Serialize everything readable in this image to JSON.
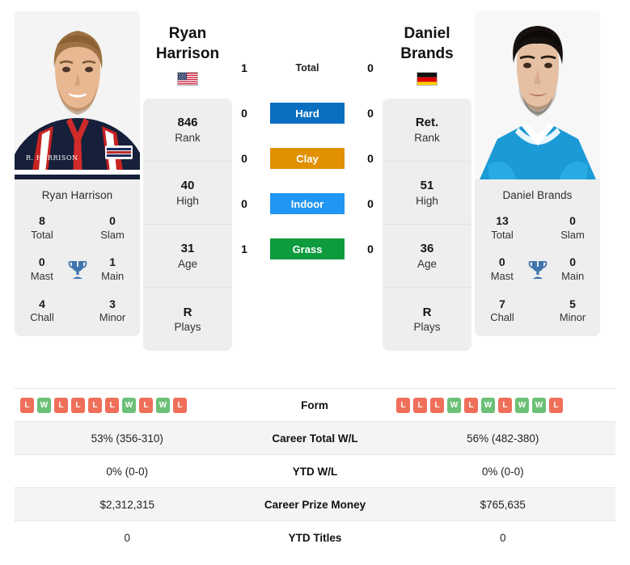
{
  "players": {
    "left": {
      "first_name": "Ryan",
      "last_name": "Harrison",
      "full_name": "Ryan Harrison",
      "country_code": "USA",
      "flag_icon": "us-flag-icon",
      "stats": [
        {
          "value": "846",
          "label": "Rank"
        },
        {
          "value": "40",
          "label": "High"
        },
        {
          "value": "31",
          "label": "Age"
        },
        {
          "value": "R",
          "label": "Plays"
        }
      ],
      "titles": {
        "total": "8",
        "slam": "0",
        "mast": "0",
        "main": "1",
        "chall": "4",
        "minor": "3"
      },
      "h2h": {
        "total": "1",
        "hard": "0",
        "clay": "0",
        "indoor": "0",
        "grass": "1"
      },
      "form": [
        "L",
        "W",
        "L",
        "L",
        "L",
        "L",
        "W",
        "L",
        "W",
        "L"
      ],
      "career_total_wl": "53% (356-310)",
      "ytd_wl": "0% (0-0)",
      "career_prize_money": "$2,312,315",
      "ytd_titles": "0"
    },
    "right": {
      "first_name": "Daniel",
      "last_name": "Brands",
      "full_name": "Daniel Brands",
      "country_code": "GER",
      "flag_icon": "de-flag-icon",
      "stats": [
        {
          "value": "Ret.",
          "label": "Rank"
        },
        {
          "value": "51",
          "label": "High"
        },
        {
          "value": "36",
          "label": "Age"
        },
        {
          "value": "R",
          "label": "Plays"
        }
      ],
      "titles": {
        "total": "13",
        "slam": "0",
        "mast": "0",
        "main": "0",
        "chall": "7",
        "minor": "5"
      },
      "h2h": {
        "total": "0",
        "hard": "0",
        "clay": "0",
        "indoor": "0",
        "grass": "0"
      },
      "form": [
        "L",
        "L",
        "L",
        "W",
        "L",
        "W",
        "L",
        "W",
        "W",
        "L"
      ],
      "career_total_wl": "56% (482-380)",
      "ytd_wl": "0% (0-0)",
      "career_prize_money": "$765,635",
      "ytd_titles": "0"
    }
  },
  "titles_labels": {
    "total": "Total",
    "slam": "Slam",
    "mast": "Mast",
    "main": "Main",
    "chall": "Chall",
    "minor": "Minor",
    "trophy_icon": "trophy-icon"
  },
  "h2h_rows": [
    {
      "key": "total",
      "label": "Total",
      "color": "transparent"
    },
    {
      "key": "hard",
      "label": "Hard",
      "color": "#0b6fc1"
    },
    {
      "key": "clay",
      "label": "Clay",
      "color": "#e19100"
    },
    {
      "key": "indoor",
      "label": "Indoor",
      "color": "#2196f3"
    },
    {
      "key": "grass",
      "label": "Grass",
      "color": "#0d9b3e"
    }
  ],
  "comparison_rows": [
    {
      "label": "Form",
      "type": "form",
      "left": "form",
      "right": "form"
    },
    {
      "label": "Career Total W/L",
      "type": "text",
      "left": "career_total_wl",
      "right": "career_total_wl"
    },
    {
      "label": "YTD W/L",
      "type": "text",
      "left": "ytd_wl",
      "right": "ytd_wl"
    },
    {
      "label": "Career Prize Money",
      "type": "text",
      "left": "career_prize_money",
      "right": "career_prize_money"
    },
    {
      "label": "YTD Titles",
      "type": "text",
      "left": "ytd_titles",
      "right": "ytd_titles"
    }
  ],
  "colors": {
    "hard": "#0b6fc1",
    "clay": "#e19100",
    "indoor": "#2196f3",
    "grass": "#0d9b3e",
    "win": "#6cc077",
    "loss": "#ef6f5a",
    "trophy": "#3f74ad",
    "card_bg": "#eeeeee"
  }
}
